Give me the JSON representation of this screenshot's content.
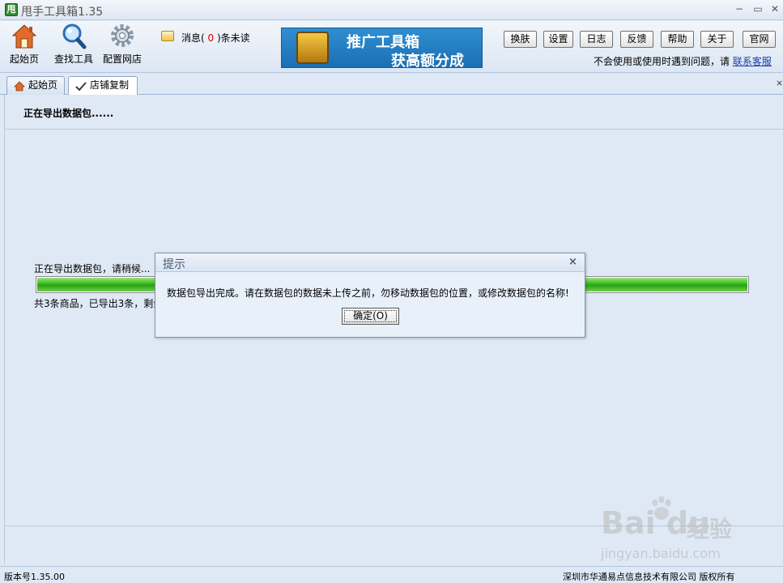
{
  "window": {
    "logo_text": "甩",
    "title": "甩手工具箱1.35",
    "minimize": "−",
    "restore": "▭",
    "close": "✕"
  },
  "toolbar": {
    "home_label": "起始页",
    "find_tools_label": "查找工具",
    "config_shop_label": "配置网店",
    "messages_prefix": "消息(",
    "messages_count": "0",
    "messages_suffix": ")条未读",
    "banner_line1": "推广工具箱",
    "banner_line2": "获高额分成",
    "buttons": [
      "换肤",
      "设置",
      "日志",
      "反馈",
      "帮助",
      "关于",
      "官网"
    ],
    "help_text": "不会使用或使用时遇到问题，请",
    "help_link": "联系客服"
  },
  "tabs": [
    {
      "label": "起始页",
      "icon": "home-icon"
    },
    {
      "label": "店铺复制",
      "icon": "copy-tick-icon"
    }
  ],
  "tab_scroll": "×",
  "main": {
    "status_header": "正在导出数据包......",
    "wait_text": "正在导出数据包，请稍候...",
    "progress_percent": 100,
    "count_text": "共3条商品，已导出3条，剩余"
  },
  "dialog": {
    "title": "提示",
    "close": "×",
    "message": "数据包导出完成。请在数据包的数据未上传之前，勿移动数据包的位置，或修改数据包的名称!",
    "ok_label": "确定(O)"
  },
  "statusbar": {
    "version": "版本号1.35.00",
    "copyright": "深圳市华通易点信息技术有限公司 版权所有"
  },
  "watermark": {
    "brand": "Bai  du",
    "product": "经验",
    "url": "jingyan.baidu.com"
  },
  "colors": {
    "accent_blue": "#1c6fb4",
    "progress_green": "#35b81d",
    "unread_red": "#e00000"
  }
}
